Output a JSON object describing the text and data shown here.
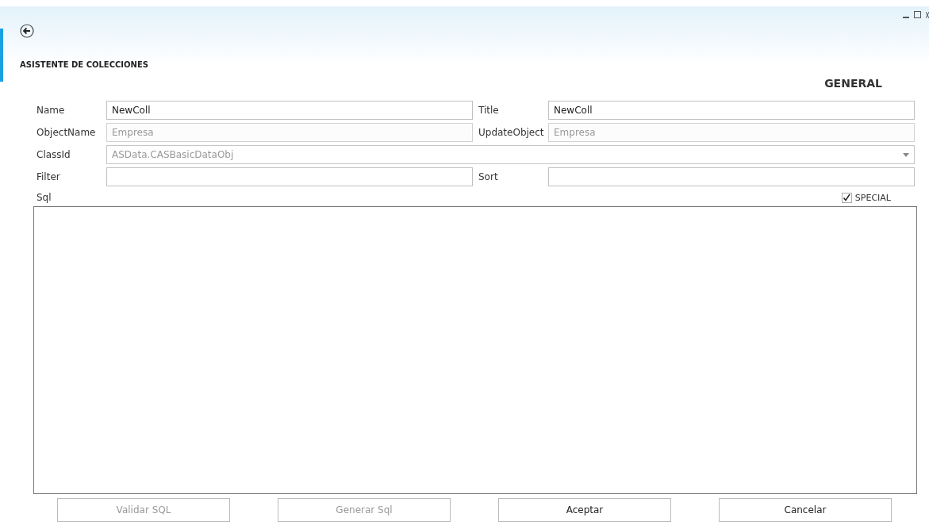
{
  "window": {
    "title": "ASISTENTE DE COLECCIONES",
    "section": "GENERAL"
  },
  "rows": [
    {
      "kind": "pair",
      "fields": [
        {
          "label": "Name",
          "value": "NewColl",
          "disabled": false
        },
        {
          "label": "Title",
          "value": "NewColl",
          "disabled": false
        }
      ]
    },
    {
      "kind": "pair",
      "fields": [
        {
          "label": "ObjectName",
          "value": "Empresa",
          "disabled": true
        },
        {
          "label": "UpdateObject",
          "value": "Empresa",
          "disabled": true
        }
      ]
    },
    {
      "kind": "select",
      "fields": [
        {
          "label": "ClassId",
          "value": "ASData.CASBasicDataObj",
          "disabled": true
        }
      ]
    },
    {
      "kind": "pair",
      "fields": [
        {
          "label": "Filter",
          "disabled": false
        },
        {
          "label": "Sort",
          "disabled": false
        }
      ]
    }
  ],
  "sql": {
    "label": "Sql",
    "special": {
      "label": "SPECIAL",
      "checked": true
    }
  },
  "buttons": [
    {
      "label": "Validar SQL",
      "disabled": true
    },
    {
      "label": "Generar Sql",
      "disabled": true
    },
    {
      "label": "Aceptar",
      "disabled": false
    },
    {
      "label": "Cancelar",
      "disabled": false
    }
  ]
}
